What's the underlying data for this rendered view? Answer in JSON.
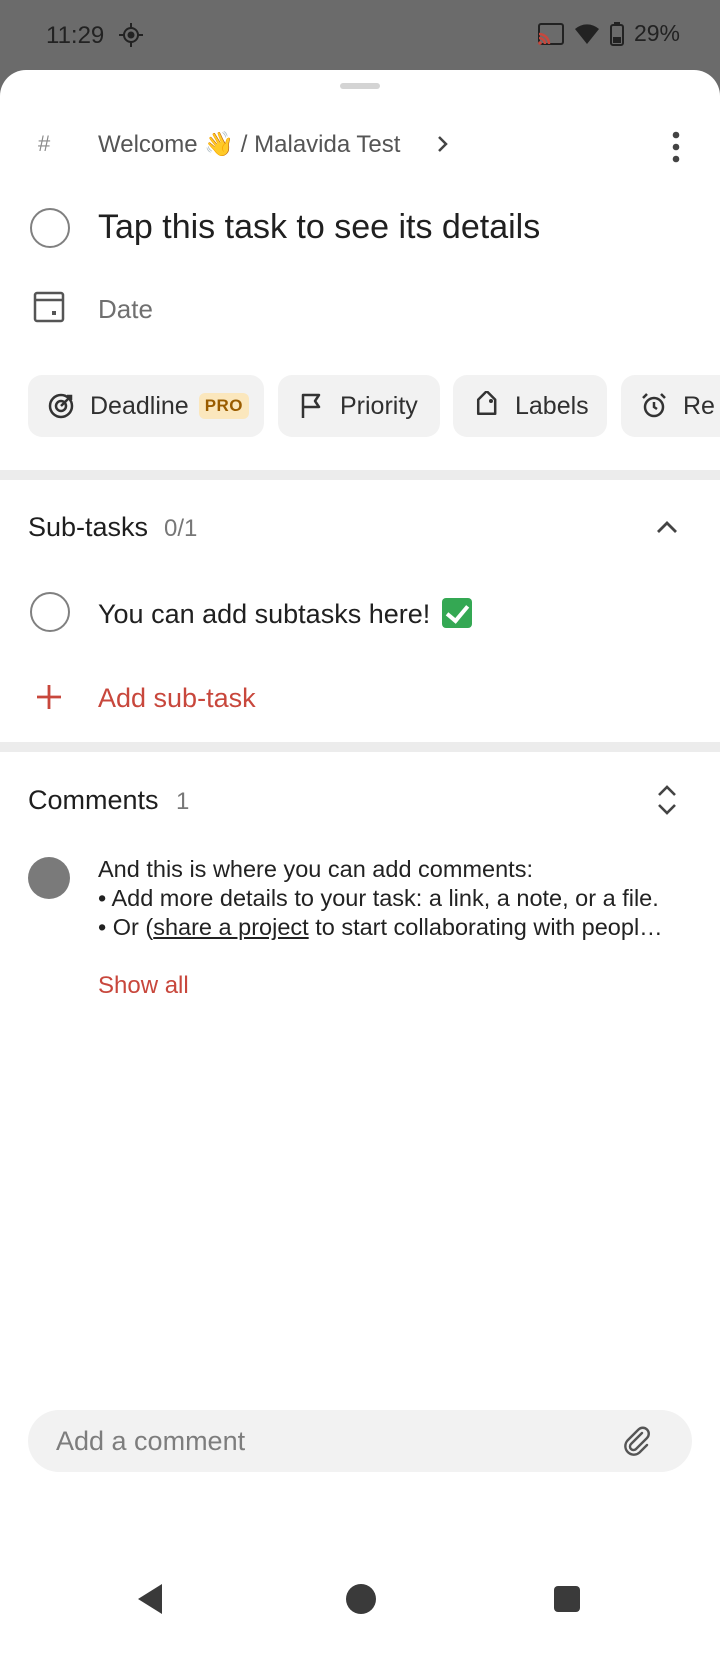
{
  "status_bar": {
    "time": "11:29",
    "battery": "29%"
  },
  "breadcrumb": {
    "hash": "#",
    "path": "Welcome 👋 / Malavida Test"
  },
  "task": {
    "title": "Tap this task to see its details"
  },
  "date": {
    "label": "Date"
  },
  "chips": {
    "deadline": "Deadline",
    "pro": "PRO",
    "priority": "Priority",
    "labels": "Labels",
    "reminders": "Re"
  },
  "subtasks": {
    "title": "Sub-tasks",
    "count": "0/1",
    "items": [
      {
        "label": "You can add subtasks here!"
      }
    ],
    "add_label": "Add sub-task"
  },
  "comments": {
    "title": "Comments",
    "count": "1",
    "line1": "And this is where you can add comments:",
    "line2": "• Add more details to your task: a link, a note, or a file.",
    "line3_prefix": "• Or (",
    "line3_link": "share a project",
    "line3_suffix": " to start collaborating with peopl…",
    "show_all": "Show all"
  },
  "comment_input": {
    "placeholder": "Add a comment"
  },
  "colors": {
    "accent": "#c8473c",
    "chip_bg": "#f2f2f2",
    "pro_bg": "#fbe7bd"
  },
  "icons": {
    "status": [
      "location-icon",
      "cast-icon",
      "wifi-icon",
      "battery-icon"
    ],
    "nav": [
      "back-icon",
      "home-icon",
      "recents-icon"
    ]
  }
}
